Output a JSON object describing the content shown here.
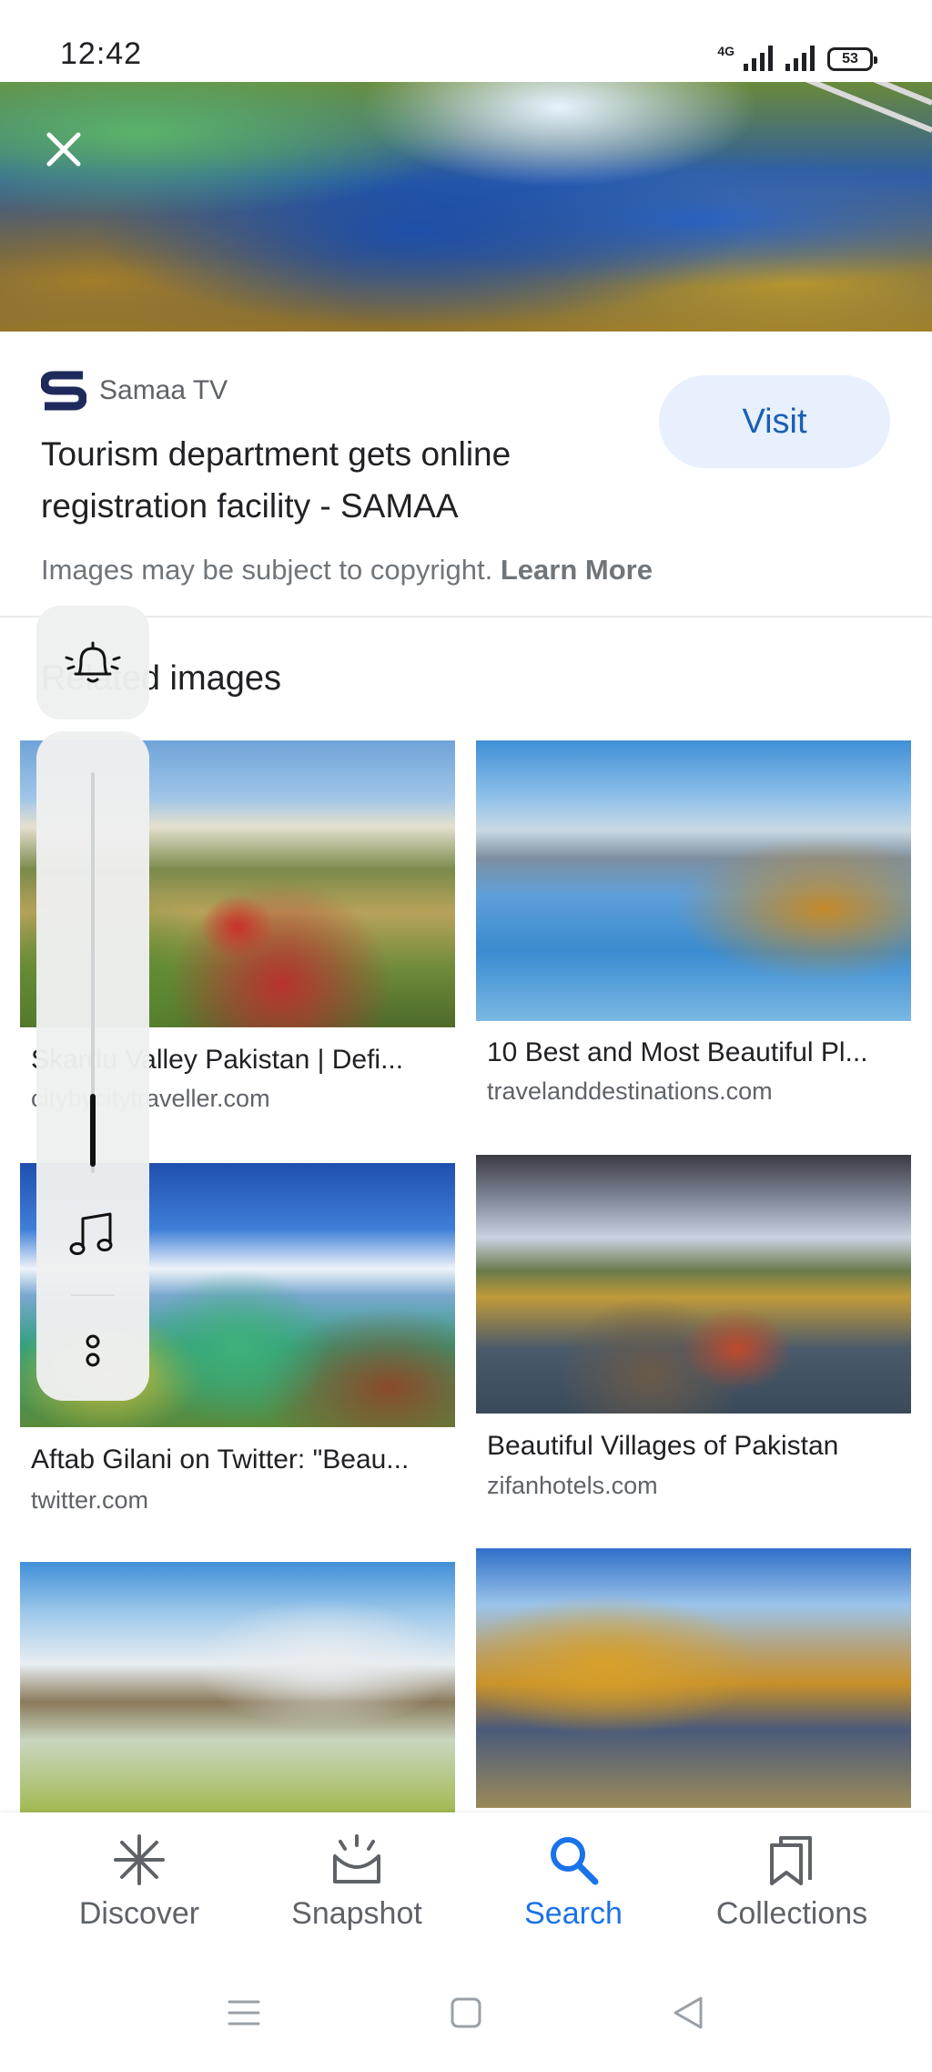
{
  "status_bar": {
    "time": "12:42",
    "network": "4G",
    "battery": "53"
  },
  "source": {
    "name": "Samaa TV",
    "title": "Tourism department gets online registration facility - SAMAA",
    "visit_label": "Visit",
    "copyright_text": "Images may be subject to copyright.",
    "learn_more_label": "Learn More"
  },
  "related": {
    "heading": "Related images",
    "items": [
      {
        "caption": "Skardu Valley Pakistan | Defi...",
        "domain": "citybycitytraveller.com"
      },
      {
        "caption": "10 Best and Most Beautiful Pl...",
        "domain": "travelanddestinations.com"
      },
      {
        "caption": "Aftab Gilani on Twitter: \"Beau...",
        "domain": "twitter.com"
      },
      {
        "caption": "Beautiful Villages of Pakistan",
        "domain": "zifanhotels.com"
      }
    ]
  },
  "bottom_nav": {
    "items": [
      {
        "label": "Discover",
        "icon": "asterisk-icon"
      },
      {
        "label": "Snapshot",
        "icon": "snapshot-icon"
      },
      {
        "label": "Search",
        "icon": "search-icon"
      },
      {
        "label": "Collections",
        "icon": "collections-icon"
      }
    ],
    "active": "Search"
  },
  "colors": {
    "accent": "#1a73e8",
    "visit_bg": "#e8f0fe",
    "visit_text": "#1a5fb4",
    "secondary_text": "#5f6368"
  },
  "volume": {
    "level_percent": 15
  }
}
